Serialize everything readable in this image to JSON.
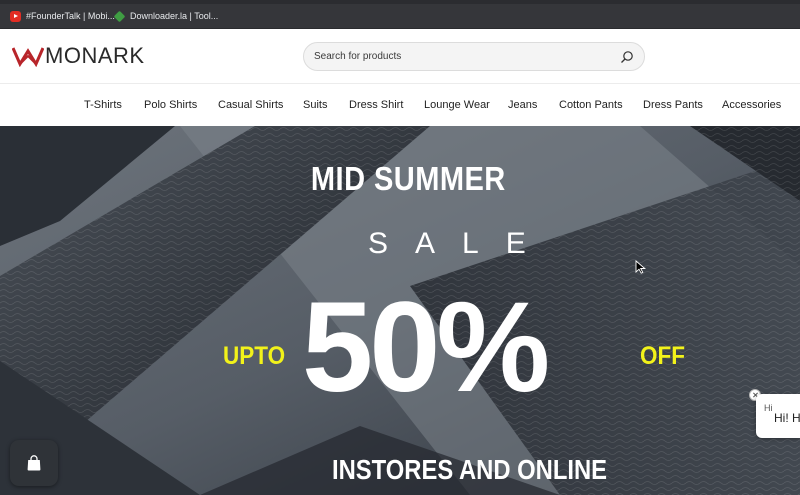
{
  "bookmarks": [
    {
      "label": "#FounderTalk | Mobi...",
      "icon": "youtube-icon"
    },
    {
      "label": "Downloader.la | Tool...",
      "icon": "downloader-icon"
    }
  ],
  "brand": {
    "name": "MONARK",
    "logo_icon": "crown-icon",
    "logo_color": "#b8252a"
  },
  "search": {
    "placeholder": "Search for products",
    "value": "",
    "icon": "search-icon"
  },
  "nav": {
    "items": [
      "T-Shirts",
      "Polo Shirts",
      "Casual Shirts",
      "Suits",
      "Dress Shirt",
      "Lounge Wear",
      "Jeans",
      "Cotton Pants",
      "Dress Pants",
      "Accessories"
    ]
  },
  "hero": {
    "headline": "MID SUMMER",
    "sale": "SALE",
    "prefix": "UPTO",
    "discount": "50%",
    "suffix": "OFF",
    "tagline": "INSTORES AND ONLINE",
    "accent_color": "#f2f21a"
  },
  "chat": {
    "greeting": "Hi! H",
    "ghost": "Hi"
  },
  "launcher": {
    "icon": "shopping-bag-icon"
  }
}
